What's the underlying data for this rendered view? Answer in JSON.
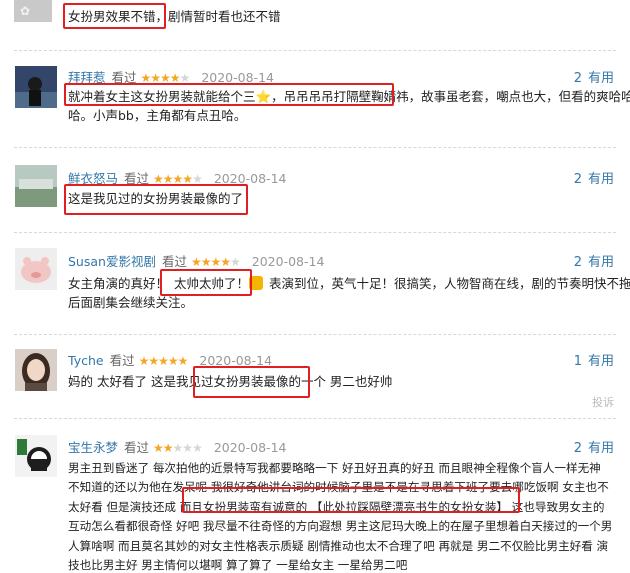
{
  "review0": {
    "text": "女扮男效果不错，剧情暂时看也还不错"
  },
  "review1": {
    "username": "拜拜惹",
    "watched": "看过",
    "stars": 4,
    "date": "2020-08-14",
    "useful_count": "2",
    "useful_label": "有用",
    "line1": "就冲着女主这女扮男装就能给个三",
    "line1b": "，吊吊吊吊打隔壁鞠婧祎，故事虽老套，嘲点也大，但看的爽哈哈",
    "line2": "哈。小声bb，主角都有点丑哈。",
    "star_emoji": "⭐"
  },
  "review2": {
    "username": "鲜衣怒马",
    "watched": "看过",
    "stars": 4,
    "date": "2020-08-14",
    "useful_count": "2",
    "useful_label": "有用",
    "line1": "这是我见过的女扮男装最像的了"
  },
  "review3": {
    "username": "Susan爱影视剧",
    "watched": "看过",
    "stars": 4,
    "date": "2020-08-14",
    "useful_count": "2",
    "useful_label": "有用",
    "line1a": "女主角演的真好！",
    "line1b": "太帅太帅了！",
    "line1c": "表演到位，英气十足！很搞笑，人物智商在线，剧的节奏明快不拖沓，",
    "line2": "后面剧集会继续关注。"
  },
  "review4": {
    "username": "Tyche",
    "watched": "看过",
    "stars": 5,
    "date": "2020-08-14",
    "useful_count": "1",
    "useful_label": "有用",
    "line1": "妈的 太好看了 这是我见过女扮男装最像的一个 男二也好帅",
    "report": "投诉"
  },
  "review5": {
    "username": "宝生永梦",
    "watched": "看过",
    "stars": 2,
    "date": "2020-08-14",
    "useful_count": "2",
    "useful_label": "有用",
    "line1": "男主丑到昏迷了 每次拍他的近景特写我都要略略一下 好丑好丑真的好丑 而且眼神全程像个盲人一样无神",
    "line2": "不知道的还以为他在发呆呢 我很好奇他讲台词的时候脑子里是不是在寻思着下班了要去哪吃饭啊 女主也不",
    "line3": "太好看 但是演技还成 而且女扮男装蛮有诚意的 【此处拉踩隔壁漂亮书生的女扮女装】 这也导致男女主的",
    "line4": "互动怎么看都很奇怪 好吧 我尽量不往奇怪的方向遐想 男主这尼玛大晚上的在屋子里想着白天接过的一个男",
    "line5": "人算啥啊 而且莫名其妙的对女主性格表示质疑 剧情推动也太不合理了吧 再就是 男二不仅脸比男主好看 演",
    "line6": "技也比男主好 男主情何以堪啊 算了算了 一星给女主 一星给男二吧"
  }
}
